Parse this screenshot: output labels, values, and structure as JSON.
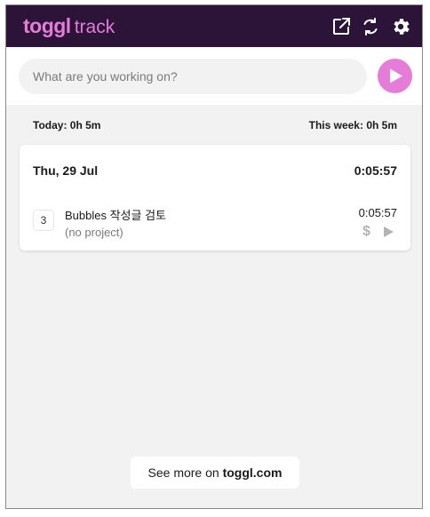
{
  "header": {
    "brand_bold": "toggl",
    "brand_light": "track",
    "colors": {
      "bg": "#2c1338",
      "accent": "#e57cd8"
    },
    "icons": [
      "open-external-icon",
      "sync-icon",
      "gear-icon"
    ]
  },
  "timer": {
    "placeholder": "What are you working on?",
    "value": "",
    "start_icon": "play-icon"
  },
  "summary": {
    "today": "Today: 0h 5m",
    "week": "This week: 0h 5m"
  },
  "day_group": {
    "date": "Thu, 29 Jul",
    "total": "0:05:57",
    "entries": [
      {
        "count": "3",
        "description": "Bubbles 작성글 검토",
        "project": "(no project)",
        "duration": "0:05:57",
        "billable_icon": "dollar-icon",
        "continue_icon": "play-icon"
      }
    ]
  },
  "footer": {
    "prefix": "See more on ",
    "link": "toggl.com"
  }
}
